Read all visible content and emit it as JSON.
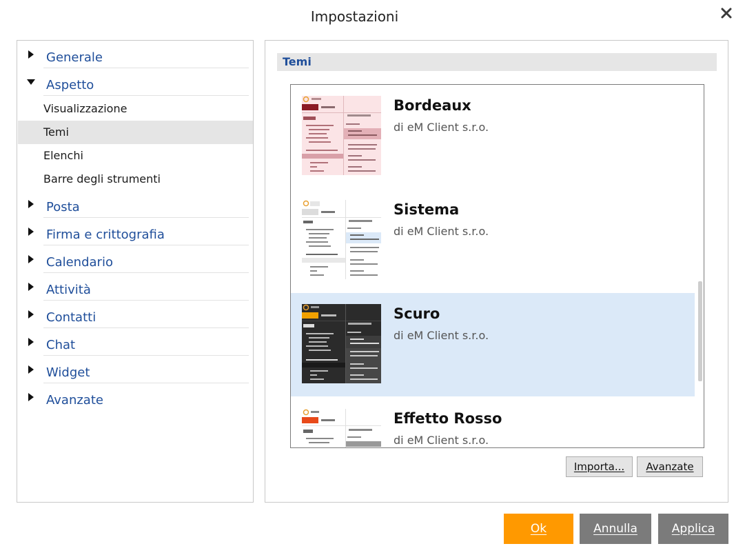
{
  "window": {
    "title": "Impostazioni",
    "close_icon": "close-icon"
  },
  "nav": {
    "sections": [
      {
        "label": "Generale",
        "expanded": false
      },
      {
        "label": "Aspetto",
        "expanded": true
      },
      {
        "label": "Posta",
        "expanded": false
      },
      {
        "label": "Firma e crittografia",
        "expanded": false
      },
      {
        "label": "Calendario",
        "expanded": false
      },
      {
        "label": "Attività",
        "expanded": false
      },
      {
        "label": "Contatti",
        "expanded": false
      },
      {
        "label": "Chat",
        "expanded": false
      },
      {
        "label": "Widget",
        "expanded": false
      },
      {
        "label": "Avanzate",
        "expanded": false
      }
    ],
    "aspetto_items": [
      {
        "label": "Visualizzazione",
        "active": false
      },
      {
        "label": "Temi",
        "active": true
      },
      {
        "label": "Elenchi",
        "active": false
      },
      {
        "label": "Barre degli strumenti",
        "active": false
      }
    ]
  },
  "content": {
    "section_title": "Temi",
    "themes": [
      {
        "name": "Bordeaux",
        "author": "di eM Client s.r.o.",
        "selected": false
      },
      {
        "name": "Sistema",
        "author": "di eM Client s.r.o.",
        "selected": false
      },
      {
        "name": "Scuro",
        "author": "di eM Client s.r.o.",
        "selected": true
      },
      {
        "name": "Effetto Rosso",
        "author": "di eM Client s.r.o.",
        "selected": false
      }
    ],
    "import_label": "Importa...",
    "advanced_label": "Avanzate"
  },
  "footer": {
    "ok_label": "Ok",
    "cancel_label": "Annulla",
    "apply_label": "Applica"
  },
  "colors": {
    "accent_orange": "#ff9900",
    "nav_blue": "#1f4e9a",
    "selected_row": "#dbe9f8",
    "button_gray": "#7b7b7b"
  }
}
